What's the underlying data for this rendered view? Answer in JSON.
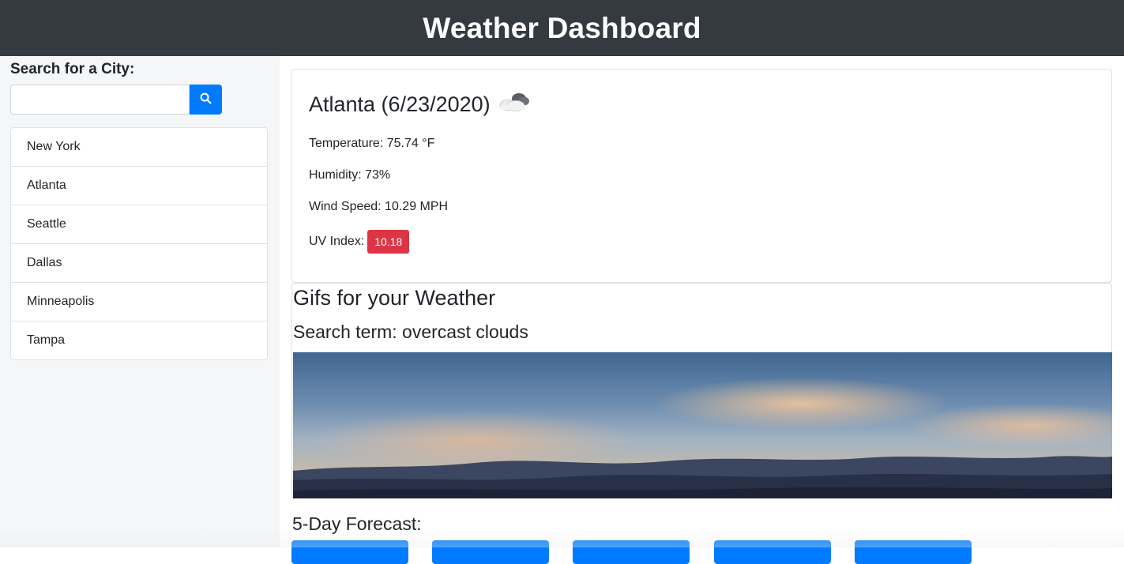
{
  "header": {
    "title": "Weather Dashboard"
  },
  "sidebar": {
    "search_label": "Search for a City:",
    "search_value": "",
    "search_button_icon": "search-icon",
    "cities": [
      "New York",
      "Atlanta",
      "Seattle",
      "Dallas",
      "Minneapolis",
      "Tampa"
    ]
  },
  "current": {
    "title": "Atlanta (6/23/2020)",
    "icon": "overcast-clouds-icon",
    "temperature": "Temperature: 75.74 °F",
    "humidity": "Humidity: 73%",
    "wind": "Wind Speed: 10.29 MPH",
    "uv_label": "UV Index:",
    "uv_value": "10.18",
    "uv_color": "#dc3545"
  },
  "gif": {
    "title": "Gifs for your Weather",
    "search_term": "Search term: overcast clouds"
  },
  "forecast": {
    "heading": "5-Day Forecast:",
    "card_color": "#007bff",
    "card_count": 5
  },
  "colors": {
    "header_bg": "#343a40",
    "accent": "#007bff",
    "sidebar_bg": "#f5f6f8"
  }
}
